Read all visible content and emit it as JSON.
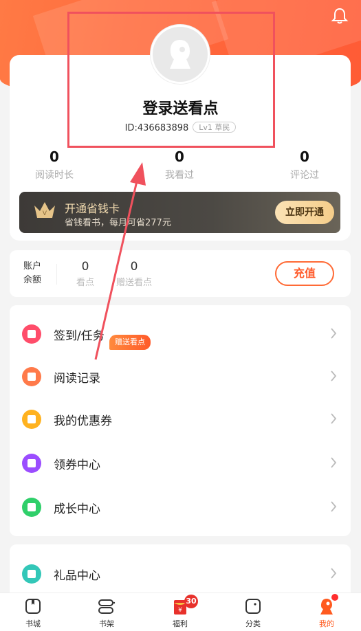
{
  "profile": {
    "nickname": "登录送看点",
    "id_text": "ID:436683898",
    "level": "Lv1 草民"
  },
  "stats": [
    {
      "value": "0",
      "label": "阅读时长"
    },
    {
      "value": "0",
      "label": "我看过"
    },
    {
      "value": "0",
      "label": "评论过"
    }
  ],
  "vip": {
    "title": "开通省钱卡",
    "subtitle": "省钱看书，每月可省277元",
    "button": "立即开通"
  },
  "balance": {
    "label": "账户余额",
    "items": [
      {
        "value": "0",
        "label": "看点"
      },
      {
        "value": "0",
        "label": "赠送看点"
      }
    ],
    "recharge": "充值"
  },
  "menu": [
    {
      "label": "签到/任务",
      "icon": "calendar-icon",
      "color": "#ff4d6a",
      "badge": "赠送看点"
    },
    {
      "label": "阅读记录",
      "icon": "book-icon",
      "color": "#ff7a4a"
    },
    {
      "label": "我的优惠券",
      "icon": "coupon-icon",
      "color": "#ffb21f"
    },
    {
      "label": "领券中心",
      "icon": "flag-icon",
      "color": "#9b4dff"
    },
    {
      "label": "成长中心",
      "icon": "star-icon",
      "color": "#2fcf6a"
    },
    {
      "label": "礼品中心",
      "icon": "gift-icon",
      "color": "#33c7b8"
    }
  ],
  "tabs": [
    {
      "label": "书城",
      "icon": "bookstore-icon"
    },
    {
      "label": "书架",
      "icon": "bookshelf-icon"
    },
    {
      "label": "福利",
      "icon": "red-envelope-icon",
      "badge": "30"
    },
    {
      "label": "分类",
      "icon": "category-icon"
    },
    {
      "label": "我的",
      "icon": "profile-icon",
      "active": true
    }
  ],
  "colors": {
    "accent": "#ff5a1f",
    "header": "#ff6a3d",
    "annotation": "#f0515d"
  }
}
